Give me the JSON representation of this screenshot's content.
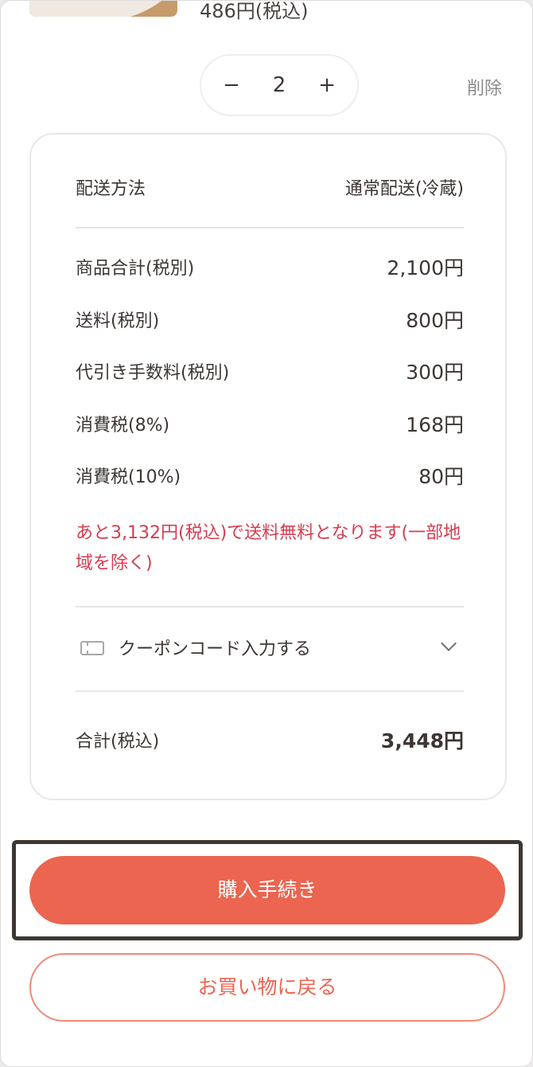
{
  "product": {
    "price": "486円(税込)"
  },
  "cart_item": {
    "quantity": "2",
    "minus_label": "−",
    "plus_label": "+",
    "delete_label": "削除"
  },
  "summary": {
    "shipping_method_label": "配送方法",
    "shipping_method_value": "通常配送(冷蔵)",
    "lines": [
      {
        "label": "商品合計(税別)",
        "value": "2,100円"
      },
      {
        "label": "送料(税別)",
        "value": "800円"
      },
      {
        "label": "代引き手数料(税別)",
        "value": "300円"
      },
      {
        "label": "消費税(8%)",
        "value": "168円"
      },
      {
        "label": "消費税(10%)",
        "value": "80円"
      }
    ],
    "free_shipping_notice": "あと3,132円(税込)で送料無料となります(一部地域を除く)",
    "coupon_label": "クーポンコード入力する",
    "total_label": "合計(税込)",
    "total_value": "3,448円"
  },
  "actions": {
    "checkout_label": "購入手続き",
    "back_label": "お買い物に戻る"
  },
  "colors": {
    "accent": "#eb6550",
    "notice": "#d63c50",
    "text": "#3d3633"
  }
}
